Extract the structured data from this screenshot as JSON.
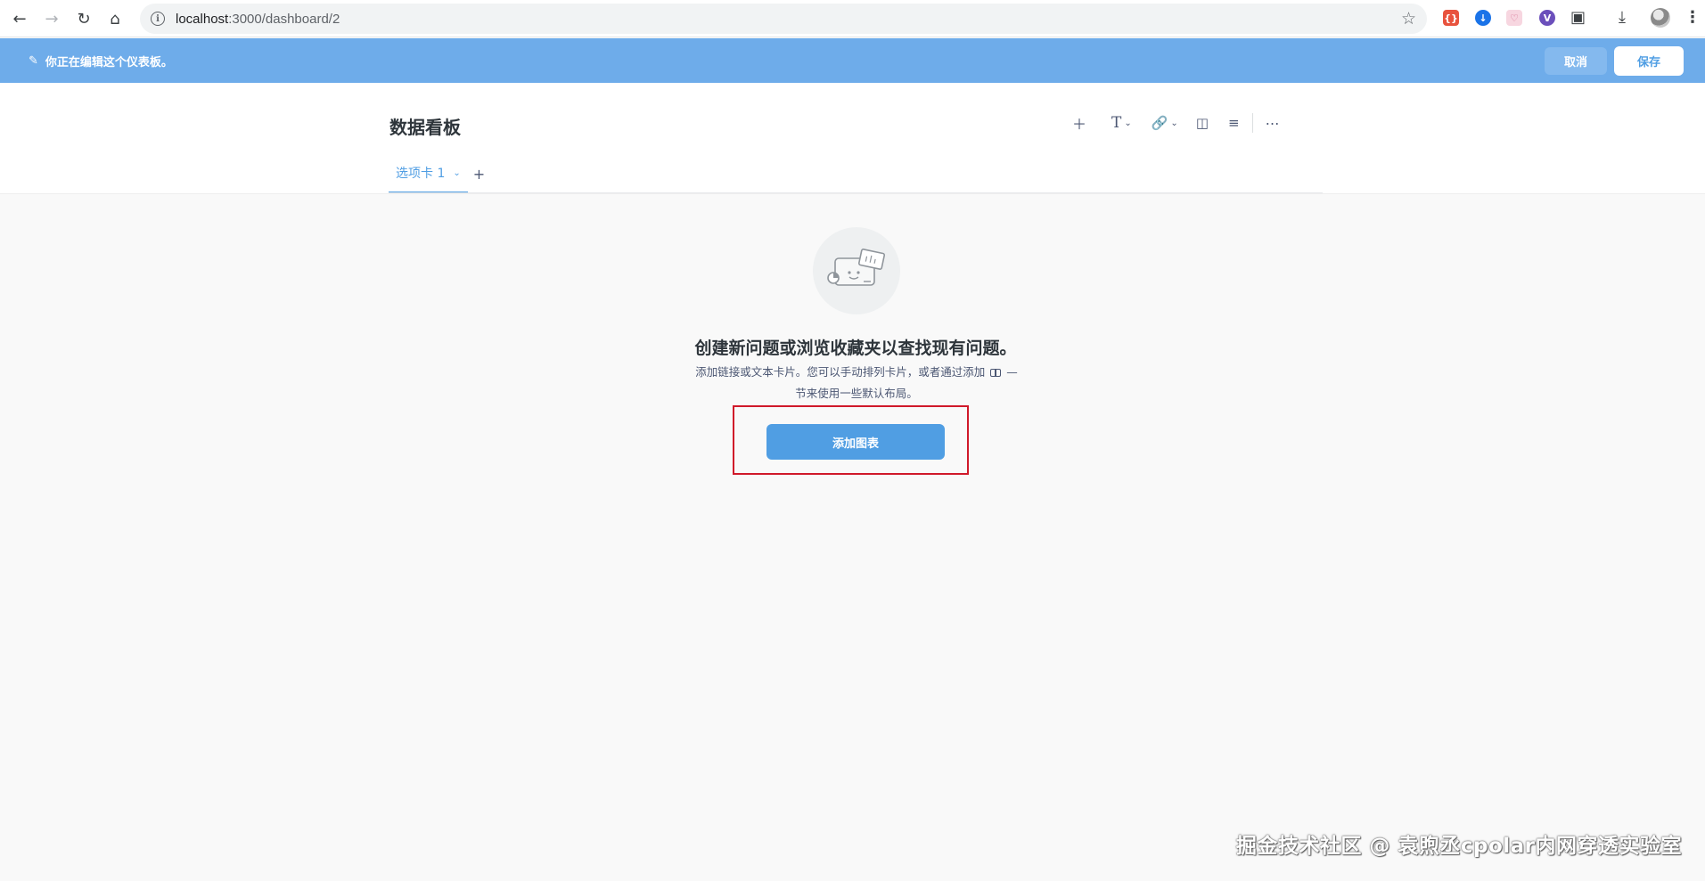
{
  "browser": {
    "url_host": "localhost",
    "url_path": ":3000/dashboard/2"
  },
  "edit_banner": {
    "message": "你正在编辑这个仪表板。",
    "cancel_label": "取消",
    "save_label": "保存"
  },
  "dashboard": {
    "title": "数据看板",
    "tabs": [
      {
        "label": "选项卡 1"
      }
    ]
  },
  "empty_state": {
    "title": "创建新问题或浏览收藏夹以查找现有问题。",
    "desc_line1": "添加链接或文本卡片。您可以手动排列卡片，或者通过添加",
    "desc_line1_tail": "—",
    "desc_line2": "节来使用一些默认布局。",
    "button_label": "添加图表"
  },
  "watermark": "掘金技术社区 @ 袁煦丞cpolar内网穿透实验室",
  "colors": {
    "brand": "#509ee3",
    "banner": "#6eacea",
    "highlight": "#d0192a"
  }
}
